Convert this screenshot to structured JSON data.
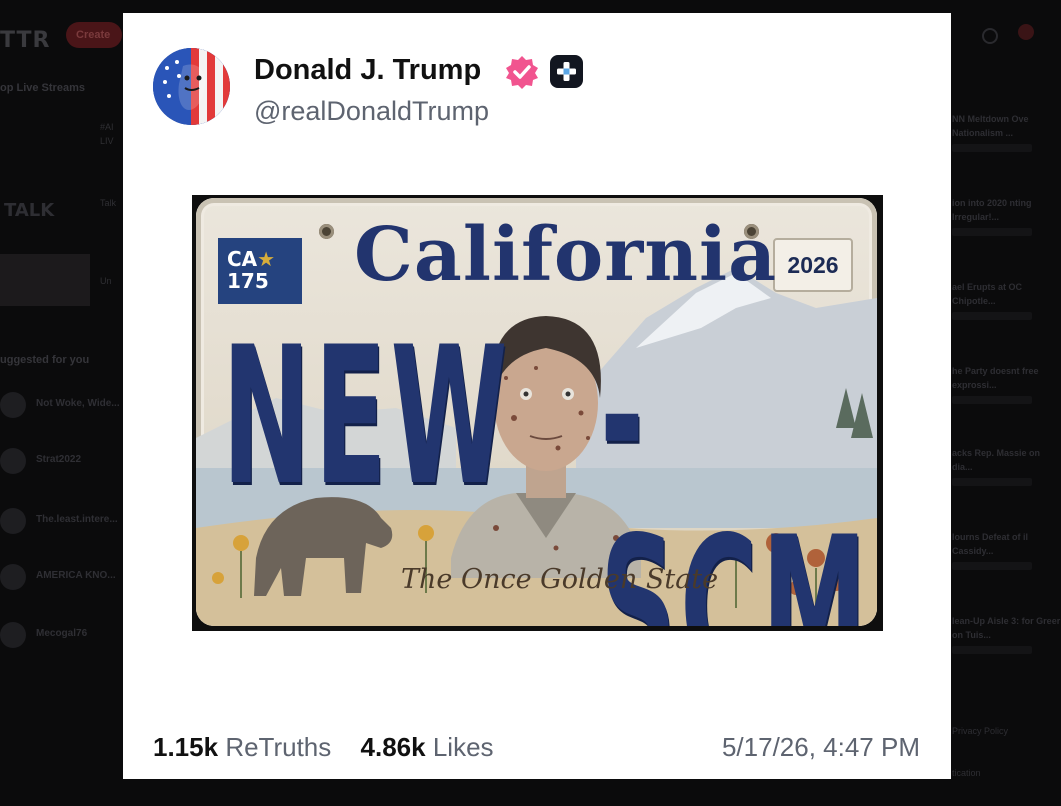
{
  "background": {
    "logo": "TTR",
    "create_button": "Create",
    "left_sections": [
      "op Live Streams",
      "uggested for you"
    ],
    "live_items": [
      "#AI",
      "LIV",
      "Talk",
      "Un"
    ],
    "talk_logo": "TALK",
    "suggested": [
      "Not Woke, Wide...",
      "Strat2022",
      "The.least.intere...",
      "AMERICA KNO...",
      "Mecogal76"
    ],
    "right_items": [
      "NN Meltdown Ove Nationalism ...",
      "ion into 2020 nting Irregular!...",
      "ael Erupts at OC Chipotle...",
      "he Party doesnt free exprossi...",
      "acks Rep. Massie on dia...",
      "lourns Defeat of il Cassidy...",
      "lean-Up Aisle 3: for Greer on Tuis...",
      "Privacy Policy",
      "tication"
    ]
  },
  "post": {
    "display_name": "Donald J. Trump",
    "handle": "@realDonaldTrump",
    "image": {
      "sticker_state": "CA",
      "sticker_number": "175",
      "state_name": "California",
      "year": "2026",
      "plate_left": "NEW",
      "plate_right": "-SCM",
      "tagline": "The Once Golden State"
    },
    "retruths_count": "1.15k",
    "retruths_label": "ReTruths",
    "likes_count": "4.86k",
    "likes_label": "Likes",
    "timestamp": "5/17/26, 4:47 PM"
  },
  "colors": {
    "verified_badge": "#f1548f",
    "plate_blue": "#22356f",
    "card_bg": "#ffffff",
    "page_bg": "#050505"
  },
  "icons": [
    "avatar",
    "verified-icon",
    "plus-badge-icon",
    "search-icon",
    "bell-icon"
  ]
}
